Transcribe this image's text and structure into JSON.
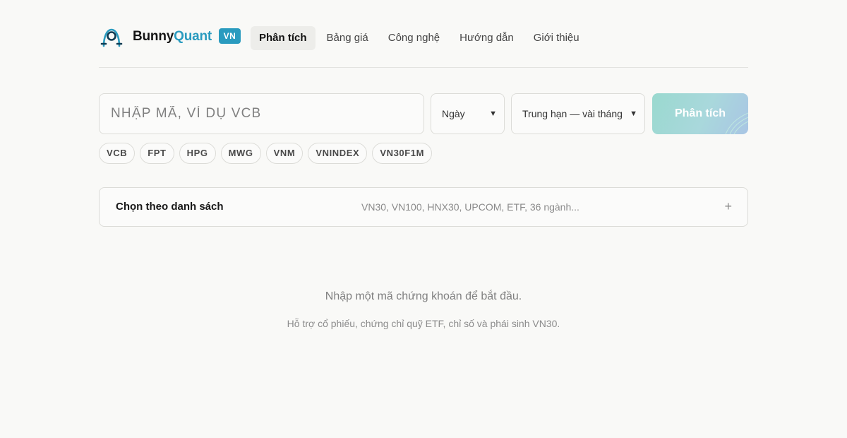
{
  "brand": {
    "name_part1": "Bunny",
    "name_part2": "Quant",
    "badge": "VN",
    "accent_color": "#2a9bbf",
    "logo_icon": "bunny-logo-icon"
  },
  "nav": {
    "items": [
      {
        "label": "Phân tích",
        "active": true
      },
      {
        "label": "Bảng giá",
        "active": false
      },
      {
        "label": "Công nghệ",
        "active": false
      },
      {
        "label": "Hướng dẫn",
        "active": false
      },
      {
        "label": "Giới thiệu",
        "active": false
      }
    ]
  },
  "search": {
    "placeholder": "NHẬP MÃ, VÍ DỤ VCB",
    "value": "",
    "timeframe": {
      "selected": "Ngày"
    },
    "horizon": {
      "selected": "Trung hạn — vài tháng"
    },
    "submit_label": "Phân tích"
  },
  "chips": [
    "VCB",
    "FPT",
    "HPG",
    "MWG",
    "VNM",
    "VNINDEX",
    "VN30F1M"
  ],
  "list_picker": {
    "title": "Chọn theo danh sách",
    "hint": "VN30, VN100, HNX30, UPCOM, ETF, 36 ngành...",
    "expand_icon": "plus-icon"
  },
  "empty_state": {
    "message": "Nhập một mã chứng khoán để bắt đầu.",
    "subtext": "Hỗ trợ cổ phiếu, chứng chỉ quỹ ETF, chỉ số và phái sinh VN30."
  }
}
